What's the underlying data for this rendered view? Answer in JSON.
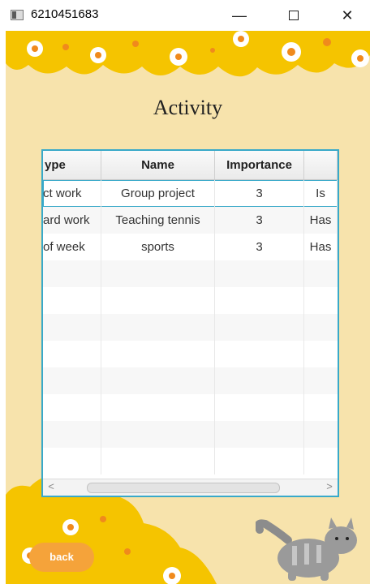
{
  "window": {
    "title": "6210451683",
    "minimize": "—",
    "close": "✕"
  },
  "page": {
    "heading": "Activity",
    "back_label": "back"
  },
  "table": {
    "columns": [
      "ype",
      "Name",
      "Importance",
      ""
    ],
    "rows": [
      [
        "ct work",
        "Group project",
        "3",
        "Is"
      ],
      [
        "ard work",
        "Teaching tennis",
        "3",
        "Has"
      ],
      [
        " of week",
        "sports",
        "3",
        "Has"
      ]
    ],
    "empty_rows": 8,
    "scroll_left": "<",
    "scroll_right": ">"
  },
  "colors": {
    "accent": "#39a9c9",
    "background": "#f7e3ac",
    "flower_yellow": "#f5c400",
    "button": "#f5a33a"
  }
}
